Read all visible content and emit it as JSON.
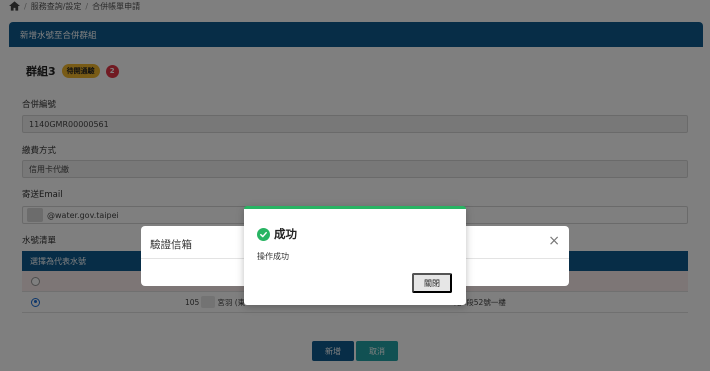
{
  "breadcrumb": {
    "home_icon": "home-icon",
    "items": [
      "服務查詢/設定",
      "合併帳單申請"
    ],
    "separator": "/"
  },
  "card": {
    "title": "新增水號至合併群組"
  },
  "group": {
    "name": "群組3",
    "status_badge": "待開通驗",
    "count_badge": "2"
  },
  "form": {
    "merge_no_label": "合併編號",
    "merge_no_value": "1140GMR00000561",
    "payment_label": "繳費方式",
    "payment_value": "信用卡代繳",
    "email_label": "寄送Email",
    "email_value": "@water.gov.taipei"
  },
  "water_list": {
    "label": "水號清單",
    "header": "選擇為代表水號",
    "rows": [
      {
        "selected": false,
        "number": "",
        "address": ""
      },
      {
        "selected": true,
        "number": "105",
        "number_suffix": "宮羽 (東",
        "address": "路1段52號一樓"
      }
    ]
  },
  "buttons": {
    "add": "新增",
    "cancel": "取消"
  },
  "verify_modal": {
    "title": "驗證信箱",
    "close_icon": "close-icon"
  },
  "success_modal": {
    "icon": "check-circle-icon",
    "title": "成功",
    "message": "操作成功",
    "close_button": "關閉"
  },
  "colors": {
    "brand_blue": "#0f5b8f",
    "success_green": "#28b463",
    "badge_yellow": "#f1b62d",
    "badge_red": "#e33545",
    "teal": "#23a3a6"
  }
}
